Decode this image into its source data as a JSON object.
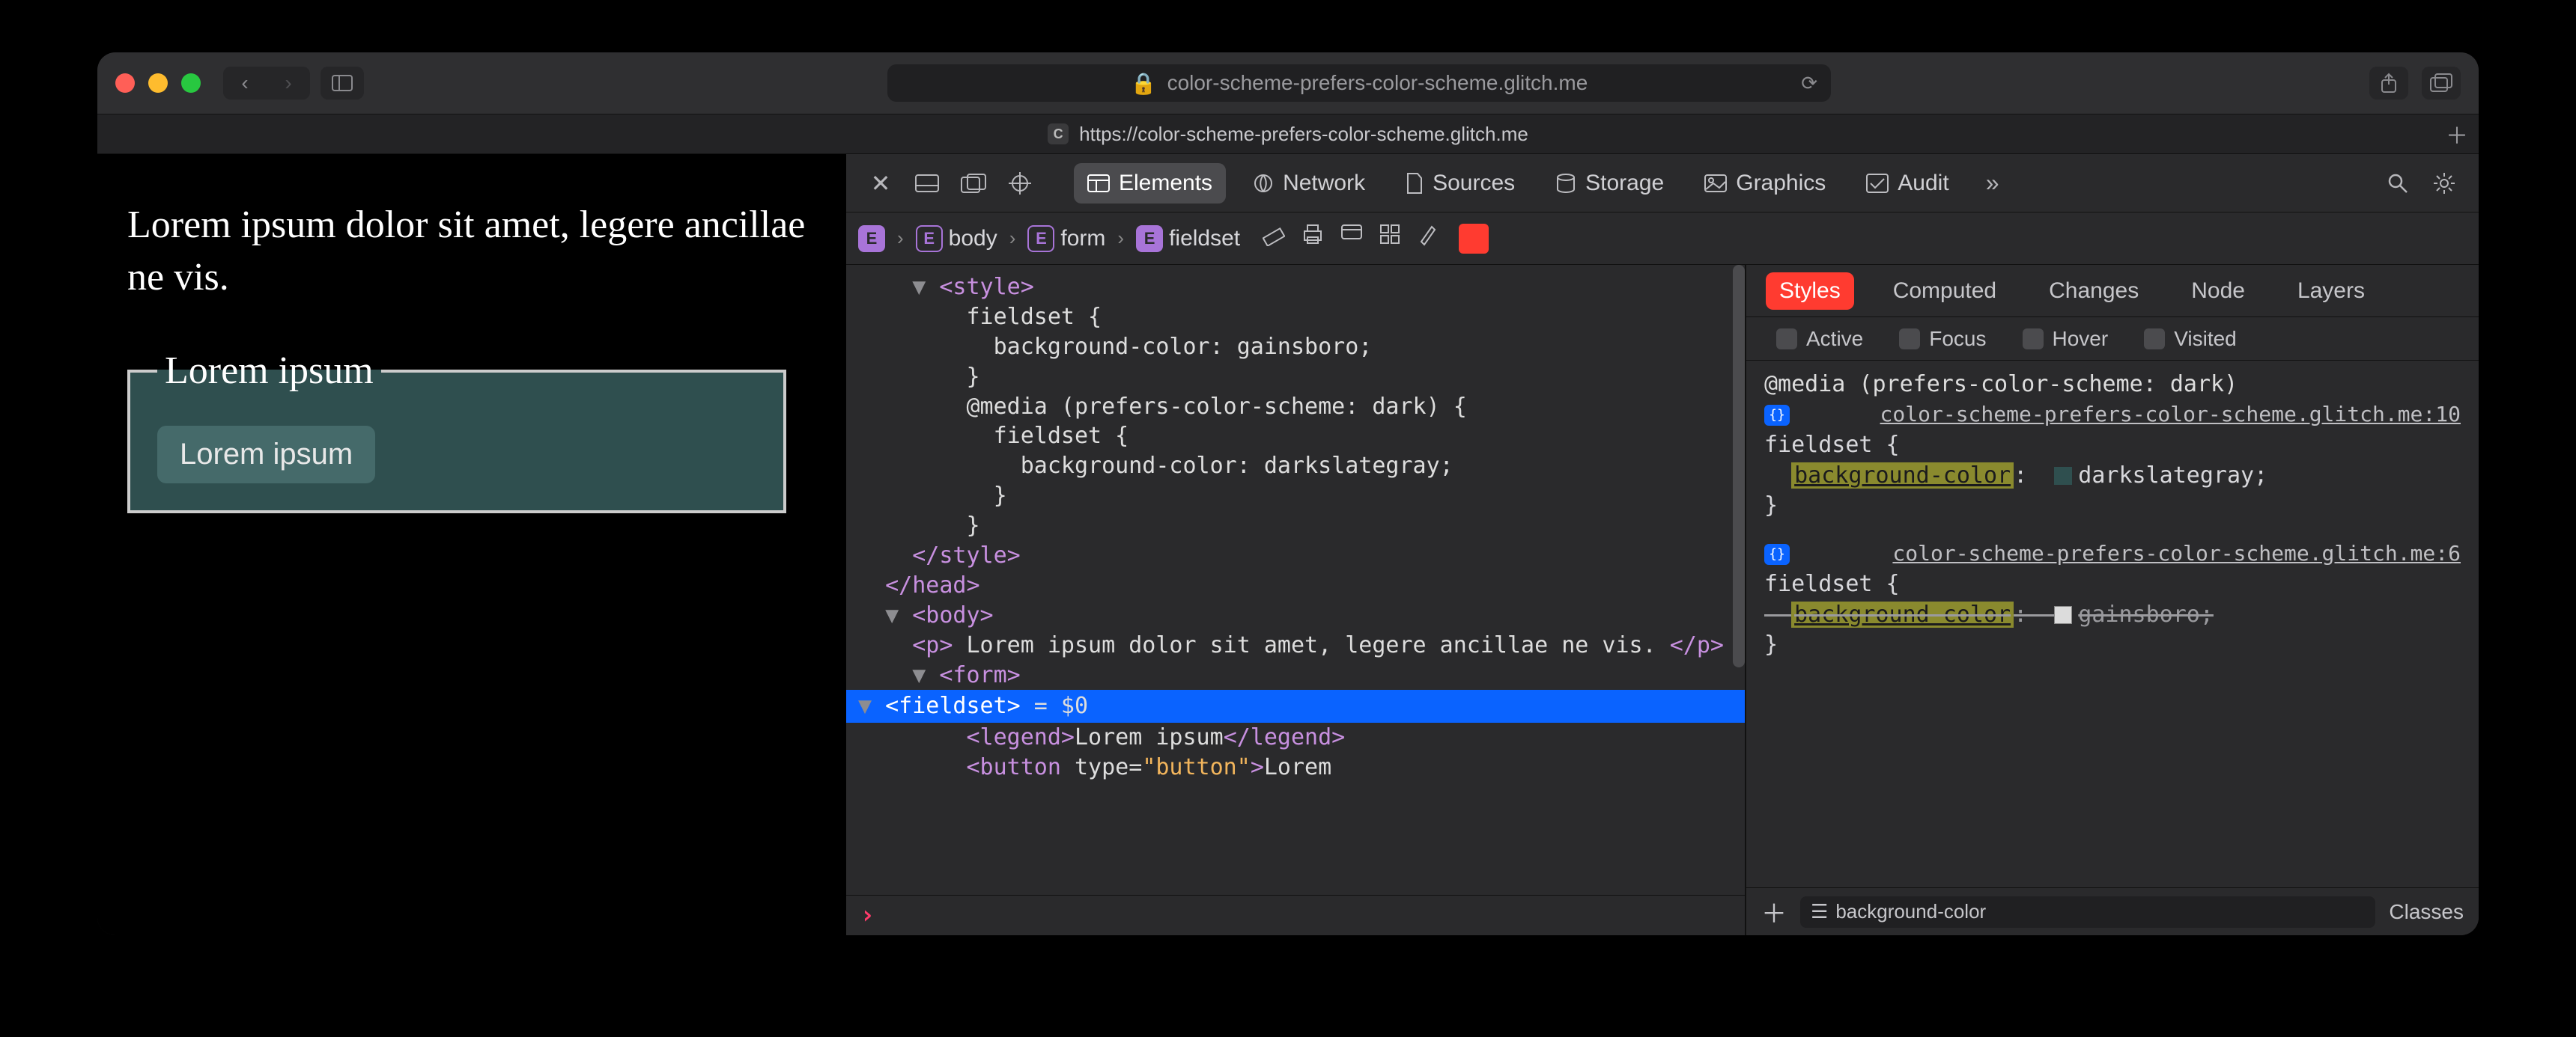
{
  "browser": {
    "address_text": "color-scheme-prefers-color-scheme.glitch.me",
    "lock_icon": "lock-icon",
    "tab_title": "https://color-scheme-prefers-color-scheme.glitch.me",
    "tab_favicon_letter": "C"
  },
  "page": {
    "paragraph": "Lorem ipsum dolor sit amet, legere ancillae ne vis.",
    "legend": "Lorem ipsum",
    "button": "Lorem ipsum"
  },
  "devtools": {
    "tabs": [
      "Elements",
      "Network",
      "Sources",
      "Storage",
      "Graphics",
      "Audit"
    ],
    "active_tab": "Elements",
    "breadcrumb": [
      "",
      "body",
      "form",
      "fieldset"
    ],
    "dom_lines": [
      {
        "indent": 2,
        "tri": "▼",
        "open": "<style>"
      },
      {
        "indent": 4,
        "text": "fieldset {"
      },
      {
        "indent": 5,
        "text": "background-color: gainsboro;"
      },
      {
        "indent": 4,
        "text": "}"
      },
      {
        "indent": 4,
        "text": "@media (prefers-color-scheme: dark) {"
      },
      {
        "indent": 5,
        "text": "fieldset {"
      },
      {
        "indent": 6,
        "text": "background-color: darkslategray;"
      },
      {
        "indent": 5,
        "text": "}"
      },
      {
        "indent": 4,
        "text": "}"
      },
      {
        "indent": 2,
        "close": "</style>"
      },
      {
        "indent": 1,
        "close": "</head>"
      },
      {
        "indent": 1,
        "tri": "▼",
        "open": "<body>"
      },
      {
        "indent": 2,
        "mixed_p": true
      },
      {
        "indent": 2,
        "tri": "▼",
        "open": "<form>"
      },
      {
        "indent": 3,
        "tri": "▼",
        "selected": true,
        "open": "<fieldset>",
        "trail": " = $0"
      },
      {
        "indent": 4,
        "legend": true
      },
      {
        "indent": 4,
        "button": true
      }
    ],
    "p_text": "Lorem ipsum dolor sit amet, legere ancillae ne vis.",
    "legend_text": "Lorem ipsum",
    "button_text": "Lorem"
  },
  "styles": {
    "tabs": [
      "Styles",
      "Computed",
      "Changes",
      "Node",
      "Layers"
    ],
    "pseudo": [
      "Active",
      "Focus",
      "Hover",
      "Visited"
    ],
    "media_query": "@media (prefers-color-scheme: dark)",
    "rule1_src": "color-scheme-prefers-color-scheme.glitch.me:10",
    "rule1_selector": "fieldset",
    "rule1_prop": "background-color",
    "rule1_val": "darkslategray",
    "rule2_src": "color-scheme-prefers-color-scheme.glitch.me:6",
    "rule2_selector": "fieldset",
    "rule2_prop": "background-color",
    "rule2_val": "gainsboro",
    "filter_text": "background-color",
    "classes_label": "Classes"
  }
}
